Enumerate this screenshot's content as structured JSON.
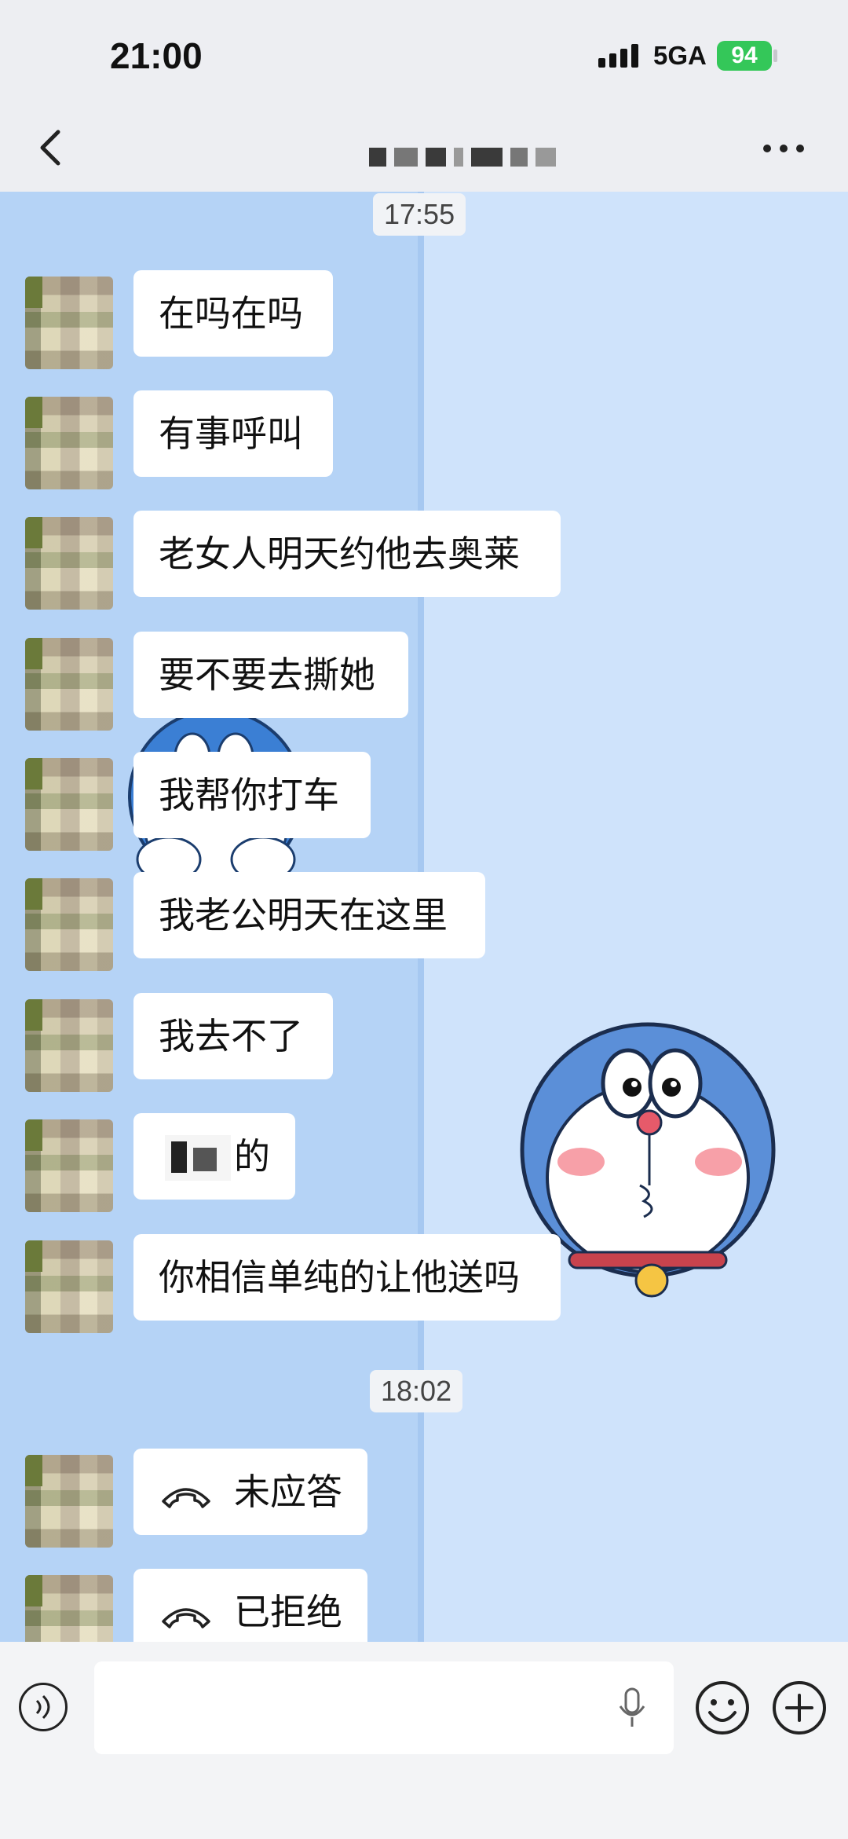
{
  "status_bar": {
    "time": "21:00",
    "network": "5GA",
    "battery": "94"
  },
  "nav": {
    "back_icon": "chevron-left-icon",
    "more_icon": "more-horizontal-icon"
  },
  "chat": {
    "timestamps": [
      "17:55",
      "18:02"
    ],
    "messages": [
      "在吗在吗",
      "有事呼叫",
      "老女人明天约他去奥莱",
      "要不要去撕她",
      "我帮你打车",
      "我老公明天在这里",
      "我去不了",
      "的",
      "你相信单纯的让他送吗"
    ],
    "calls": [
      {
        "icon": "phone-hangup-icon",
        "label": "未应答"
      },
      {
        "icon": "phone-hangup-icon",
        "label": "已拒绝"
      }
    ]
  },
  "input_bar": {
    "placeholder": ""
  },
  "colors": {
    "chat_bg": "#cfe3fb",
    "panel_bg": "#b5d3f6",
    "bubble": "#ffffff",
    "battery": "#34c759"
  }
}
